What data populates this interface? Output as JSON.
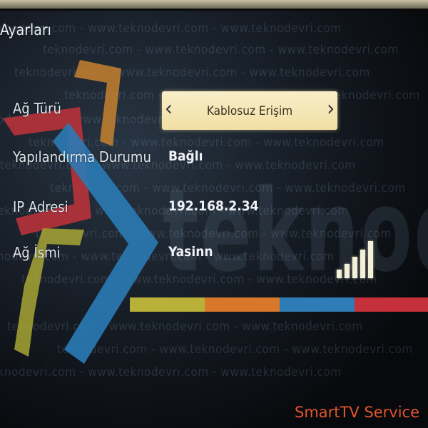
{
  "page_title": "Ayarları",
  "watermark": {
    "line_text": "teknodevri.com - www.teknodevri.com - www.teknodevri.com",
    "big_text": "teknodevri"
  },
  "rows": [
    {
      "label": "Ağ Türü",
      "value": "Kablosuz Erişim",
      "type": "selector"
    },
    {
      "label": "Yapılandırma Durumu",
      "value": "Bağlı"
    },
    {
      "label": "IP Adresi",
      "value": "192.168.2.34"
    },
    {
      "label": "Ağ İsmi",
      "value": "Yasinn"
    }
  ],
  "selector": {
    "left_arrow": "‹",
    "right_arrow": "›"
  },
  "signal": {
    "icon": "wifi-signal-bars-icon",
    "bars_filled": 5,
    "bars_total": 5
  },
  "color_strip": [
    "#b9b03a",
    "#d9772a",
    "#2f7db7",
    "#c6303a"
  ],
  "caption": "SmartTV Service"
}
